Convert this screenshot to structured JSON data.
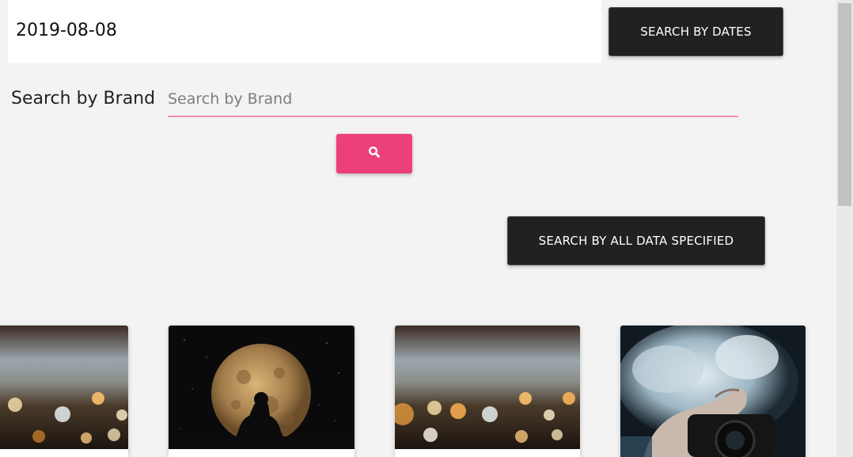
{
  "date_filter": {
    "value": "2019-08-08"
  },
  "buttons": {
    "search_by_dates": "SEARCH BY DATES",
    "search_by_all": "SEARCH BY ALL DATA SPECIFIED"
  },
  "brand_search": {
    "label": "Search by Brand",
    "placeholder": "Search by Brand",
    "button_icon": "search-icon"
  },
  "cards": [
    {
      "image": "bokeh-lights-image"
    },
    {
      "image": "moon-silhouette-image"
    },
    {
      "image": "bokeh-lights-image"
    },
    {
      "image": "camera-smoke-image"
    }
  ],
  "colors": {
    "dark_button": "#212121",
    "accent": "#ec407a",
    "underline": "#f48fb1",
    "background": "#f3f3f3"
  }
}
